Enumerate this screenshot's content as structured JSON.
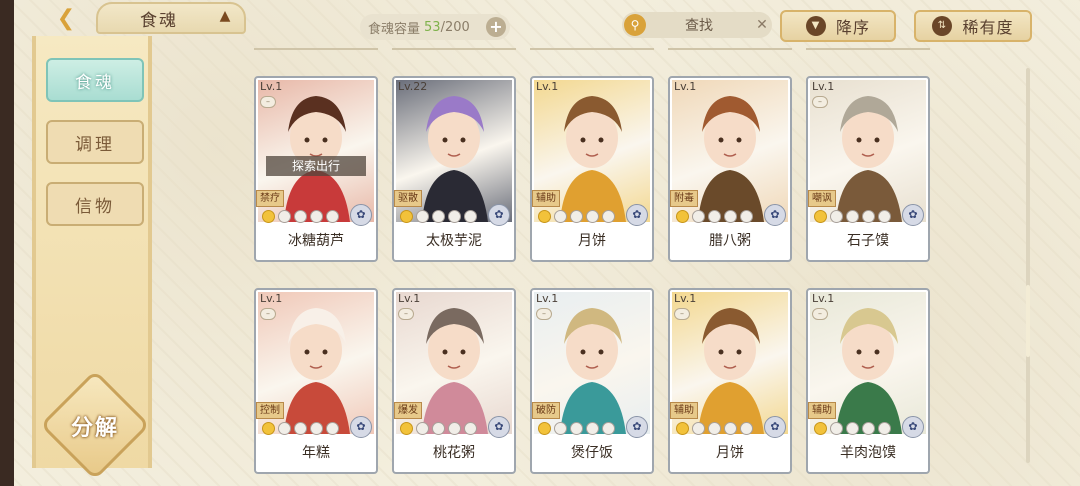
{
  "header": {
    "title": "食魂",
    "capacity_label": "食魂容量",
    "capacity_current": "53",
    "capacity_max": "/200",
    "search_label": "查找",
    "sort_order_label": "降序",
    "sort_by_label": "稀有度"
  },
  "sidebar": {
    "items": [
      {
        "label": "食魂",
        "active": true
      },
      {
        "label": "调理",
        "active": false
      },
      {
        "label": "信物",
        "active": false
      }
    ],
    "decompose_label": "分解"
  },
  "cards": [
    {
      "level": "Lv.1",
      "name": "冰糖葫芦",
      "role": "禁疗",
      "stars_lit": 1,
      "status": "探索出行",
      "palette": [
        "#e8b8a8",
        "#c83a3a",
        "#5a3020"
      ]
    },
    {
      "level": "Lv.22",
      "name": "太极芋泥",
      "role": "驱散",
      "stars_lit": 1,
      "status": "",
      "palette": [
        "#6a6e7a",
        "#2a2a34",
        "#9a7ac8"
      ]
    },
    {
      "level": "Lv.1",
      "name": "月饼",
      "role": "辅助",
      "stars_lit": 1,
      "status": "",
      "palette": [
        "#f3d890",
        "#e0a030",
        "#8a5a30"
      ]
    },
    {
      "level": "Lv.1",
      "name": "腊八粥",
      "role": "附毒",
      "stars_lit": 1,
      "status": "",
      "palette": [
        "#f0d8b8",
        "#6a4a2a",
        "#a05a30"
      ]
    },
    {
      "level": "Lv.1",
      "name": "石子馍",
      "role": "嘲讽",
      "stars_lit": 1,
      "status": "",
      "palette": [
        "#e8e0d0",
        "#7a5a3a",
        "#b0a898"
      ]
    },
    {
      "level": "Lv.1",
      "name": "年糕",
      "role": "控制",
      "stars_lit": 1,
      "status": "",
      "palette": [
        "#f0c8b8",
        "#c84a3a",
        "#f8f0e8"
      ]
    },
    {
      "level": "Lv.1",
      "name": "桃花粥",
      "role": "爆发",
      "stars_lit": 1,
      "status": "",
      "palette": [
        "#e8d8d0",
        "#d08a9a",
        "#7a6a60"
      ]
    },
    {
      "level": "Lv.1",
      "name": "煲仔饭",
      "role": "破防",
      "stars_lit": 1,
      "status": "",
      "palette": [
        "#e8eef0",
        "#3a9a9a",
        "#d0b880"
      ]
    },
    {
      "level": "Lv.1",
      "name": "月饼",
      "role": "辅助",
      "stars_lit": 1,
      "status": "",
      "palette": [
        "#f3d890",
        "#e0a030",
        "#8a5a30"
      ]
    },
    {
      "level": "Lv.1",
      "name": "羊肉泡馍",
      "role": "辅助",
      "stars_lit": 1,
      "status": "",
      "palette": [
        "#e8e8d8",
        "#3a7a4a",
        "#d8c890"
      ]
    }
  ]
}
